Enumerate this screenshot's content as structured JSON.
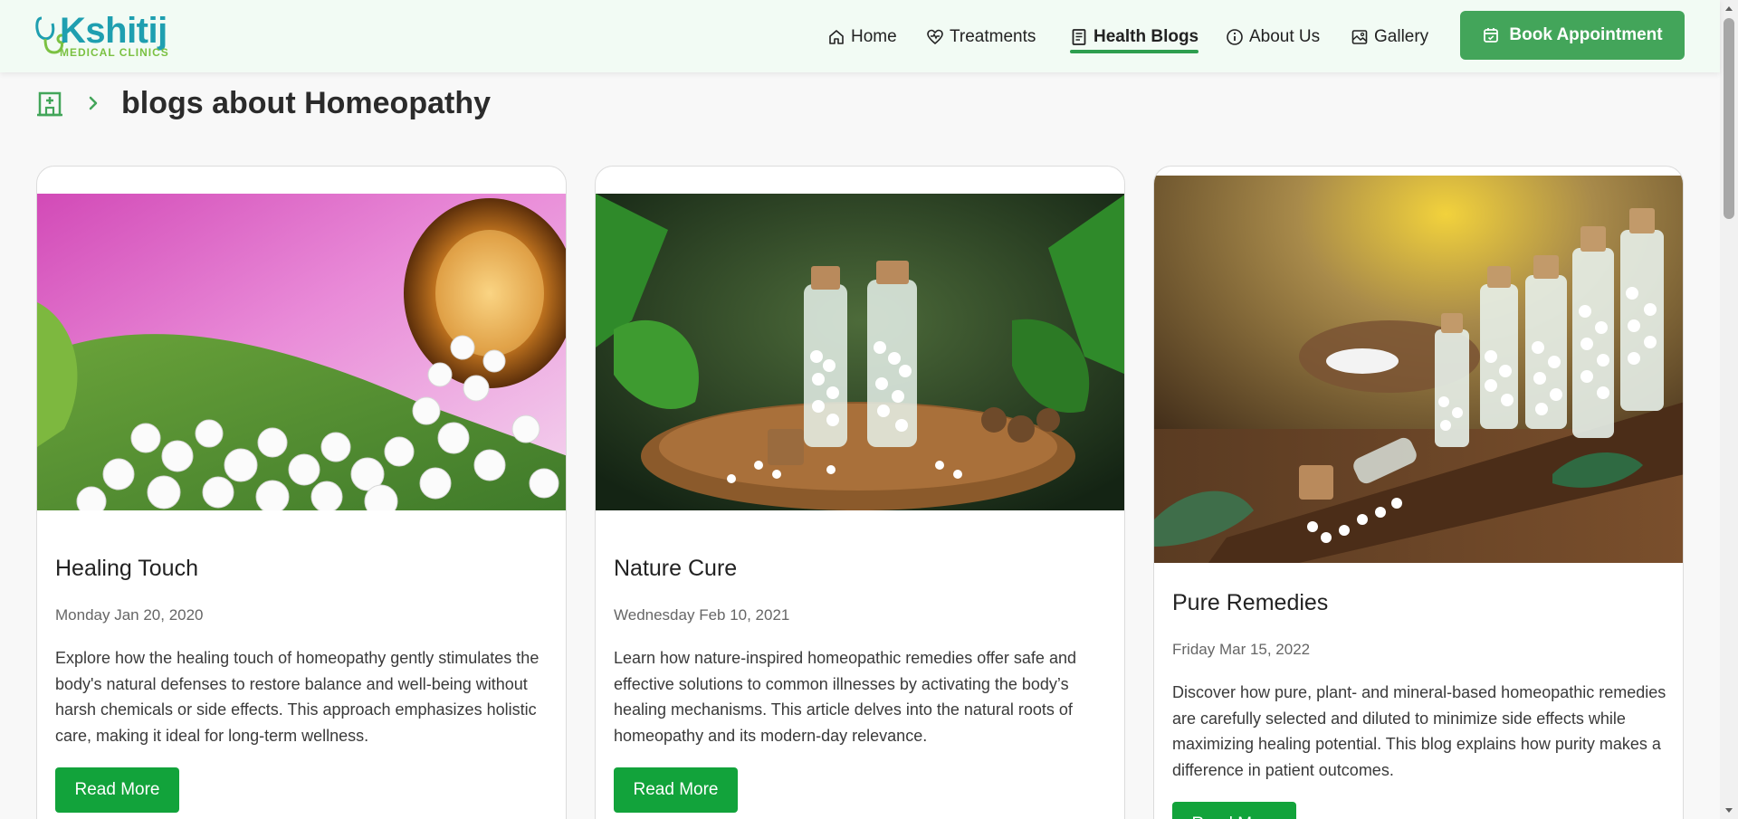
{
  "brand": {
    "name": "Kshitij",
    "tagline": "MEDICAL CLINICS"
  },
  "nav": {
    "items": [
      {
        "label": "Home",
        "icon": "home-icon"
      },
      {
        "label": "Treatments",
        "icon": "heart-pulse-icon"
      },
      {
        "label": "Health Blogs",
        "icon": "blog-icon",
        "active": true
      },
      {
        "label": "About Us",
        "icon": "info-icon"
      },
      {
        "label": "Gallery",
        "icon": "gallery-icon"
      }
    ],
    "cta": "Book Appointment"
  },
  "breadcrumb": {
    "title": "blogs about Homeopathy"
  },
  "cards": [
    {
      "title": "Healing Touch",
      "date": "Monday Jan 20, 2020",
      "text": "Explore how the healing touch of homeopathy gently stimulates the body's natural defenses to restore balance and well-being without harsh chemicals or side effects. This approach emphasizes holistic care, making it ideal for long-term wellness.",
      "button": "Read More"
    },
    {
      "title": "Nature Cure",
      "date": "Wednesday Feb 10, 2021",
      "text": "Learn how nature-inspired homeopathic remedies offer safe and effective solutions to common illnesses by activating the body’s healing mechanisms. This article delves into the natural roots of homeopathy and its modern-day relevance.",
      "button": "Read More"
    },
    {
      "title": "Pure Remedies",
      "date": "Friday Mar 15, 2022",
      "text": "Discover how pure, plant- and mineral-based homeopathic remedies are carefully selected and diluted to minimize side effects while maximizing healing potential. This blog explains how purity makes a difference in patient outcomes.",
      "button": "Read More"
    }
  ],
  "colors": {
    "accent": "#43a55a",
    "read_button": "#12a33b",
    "logo_primary": "#1f9fb0",
    "logo_secondary": "#7bc142"
  }
}
